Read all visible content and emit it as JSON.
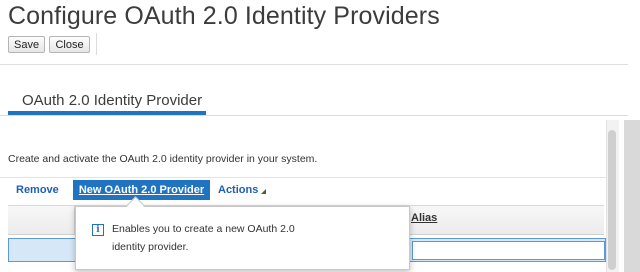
{
  "page": {
    "title": "Configure OAuth 2.0 Identity Providers"
  },
  "toolbar": {
    "save_label": "Save",
    "close_label": "Close"
  },
  "tabs": [
    {
      "label": "OAuth 2.0 Identity Provider",
      "active": true
    }
  ],
  "main": {
    "description": "Create and activate the OAuth 2.0 identity provider in your system.",
    "actions": {
      "remove_label": "Remove",
      "new_provider_label": "New OAuth 2.0 Provider",
      "actions_label": "Actions"
    },
    "table": {
      "columns": [
        "Alias"
      ]
    }
  },
  "tooltip": {
    "icon": "info-icon",
    "lines": [
      "Enables you to create a new OAuth 2.0",
      "identity provider."
    ]
  },
  "colors": {
    "accent": "#1f73c1",
    "link": "#1f5fb3",
    "selected_row": "#d6e8f8"
  }
}
